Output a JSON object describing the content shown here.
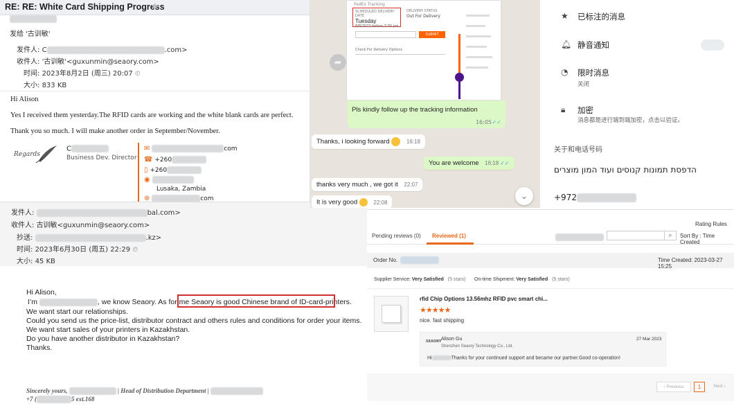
{
  "email1": {
    "subject": "RE: RE: White Card Shipping Progress",
    "sent_to": "发给 '古训敏'",
    "from_label": "发件人:",
    "from_value": "C",
    "from_suffix": ".com>",
    "to_label": "收件人:",
    "to_value": "'古训敏'<guxunmin@seaory.com>",
    "time_label": "时间:",
    "time_value": "2023年8月2日 (周三) 20:07",
    "size_label": "大小:",
    "size_value": "833 KB",
    "greeting": "Hi Alison",
    "line1": "Yes I received them yesterday.The RFID cards are working and the white blank cards are perfect.",
    "line2": "Thank you so much. I will make another order in September/November.",
    "regards": "Regards",
    "sig_name": "C",
    "sig_title": "Business Dev. Director",
    "sig_email_suffix": "com",
    "sig_phone1": "+260",
    "sig_phone2": "+260",
    "sig_city": "Lusaka, Zambia",
    "sig_web_suffix": "com"
  },
  "email2": {
    "from_label": "发件人:",
    "from_suffix": "bal.com>",
    "to_label": "收件人:",
    "to_value": "古训敏<guxunmin@seaory.com>",
    "cc_label": "抄送:",
    "cc_suffix": ".kz>",
    "time_label": "时间:",
    "time_value": "2023年6月30日 (周五) 22:29",
    "size_label": "大小:",
    "size_value": "45 KB",
    "greeting": "Hi Alison,",
    "line1_a": "I’m",
    "line1_b": ", we know Seaory. As for me",
    "highlight": "Seaory is good Chinese brand of ID-card-printers.",
    "line2": "We want start our relationships.",
    "line3": "Could you send us the price-list, distributor contract and others rules and conditions for order your items.",
    "line4": "We want start sales of your printers in Kazakhstan.",
    "line5": "Do you have another distributor in Kazakhstan?",
    "line6": "Thanks.",
    "sig1_a": "Sincerely yours,",
    "sig1_b": "| Head of Distribution Department |",
    "sig2_a": "+7 (",
    "sig2_b": "5 ext.168"
  },
  "chat": {
    "tracking_tabs": "FedEx Tracking",
    "delivery_label": "SCHEDULED DELIVERY DATE",
    "delivery_day": "Tuesday",
    "delivery_date": "8/8/2023 before 3:00 pm",
    "delivery_status_label": "DELIVERY STATUS",
    "delivery_status": "Out For Delivery",
    "submit": "SUBMIT",
    "check_options": "Check For Delivery Options",
    "m1": "Pls kindly follow up the tracking information",
    "m1_time": "16:05",
    "m2": "Thanks, i looking forward",
    "m2_time": "16:18",
    "m3": "You are welcome",
    "m3_time": "16:18",
    "m4": "thanks very much , we got it",
    "m4_time": "22:07",
    "m5": "It is very good",
    "m5_time": "22:08"
  },
  "info": {
    "starred": "已标注的消息",
    "mute": "静音通知",
    "disappearing": "限时消息",
    "disappearing_sub": "关闭",
    "encryption": "加密",
    "encryption_sub": "消息都是进行端到端加密，点击以验证。",
    "about_label": "关于和电话号码",
    "about_text": "הדפסת תמונות קנוסים ועוד המון מוצרים",
    "phone": "+972"
  },
  "reviews": {
    "tab_pending": "Pending reviews (0)",
    "tab_reviewed": "Reviewed (1)",
    "rating_rules": "Rating Rules",
    "sort_label": "Sort By : Time Created",
    "order_no": "Order No.",
    "time_created": "Time Created: 2023-03-27 15:25",
    "supplier_service_label": "Supplier Service:",
    "supplier_service_value": "Very Satisfied",
    "supplier_stars": "(5 stars)",
    "ontime_label": "On-time Shipment:",
    "ontime_value": "Very Satisfied",
    "ontime_stars": "(5 stars)",
    "product_title": "rfid Chip Options 13.56mhz RFID pvc smart chi...",
    "rating_value": 5,
    "review_text": "nice. fast shipping",
    "reply_name": "Alison Gu",
    "reply_date": "27 Mar 2023",
    "reply_company": "Shenzhen Seaory Technology Co., Ltd.",
    "reply_a": "Hi",
    "reply_b": "Thanks for your continued support and became our partner.Good co-operation!",
    "prev": "Previous",
    "page": "1",
    "next": "Next"
  },
  "colors": {
    "accent_orange": "#e8671a",
    "red_box": "#d32f2f",
    "chat_out": "#dcf8c6",
    "tab_active": "#e8671a"
  }
}
